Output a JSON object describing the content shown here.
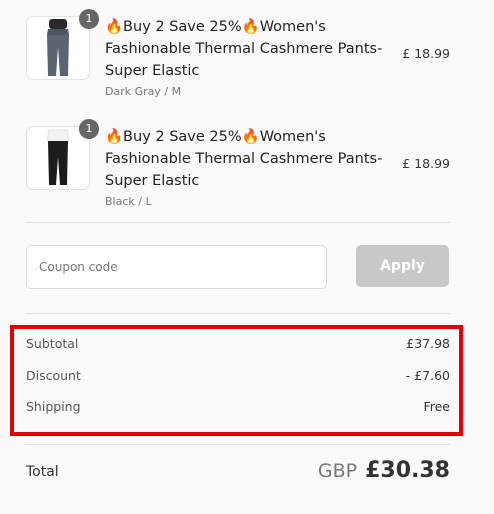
{
  "items": [
    {
      "quantity": "1",
      "title": "🔥Buy 2 Save 25%🔥Women's Fashionable Thermal Cashmere Pants- Super Elastic",
      "variant": "Dark Gray / M",
      "price": "£ 18.99",
      "pants_color": "#5b6570"
    },
    {
      "quantity": "1",
      "title": "🔥Buy 2 Save 25%🔥Women's Fashionable Thermal Cashmere Pants- Super Elastic",
      "variant": "Black / L",
      "price": "£ 18.99",
      "pants_color": "#1c1c1c"
    }
  ],
  "coupon": {
    "placeholder": "Coupon code",
    "value": "",
    "apply_label": "Apply"
  },
  "summary": {
    "subtotal_label": "Subtotal",
    "subtotal_value": "£37.98",
    "discount_label": "Discount",
    "discount_value": "- £7.60",
    "shipping_label": "Shipping",
    "shipping_value": "Free"
  },
  "total": {
    "label": "Total",
    "currency": "GBP",
    "amount": "£30.38"
  },
  "colors": {
    "highlight": "#e30000",
    "apply_disabled": "#c8c8c8"
  }
}
